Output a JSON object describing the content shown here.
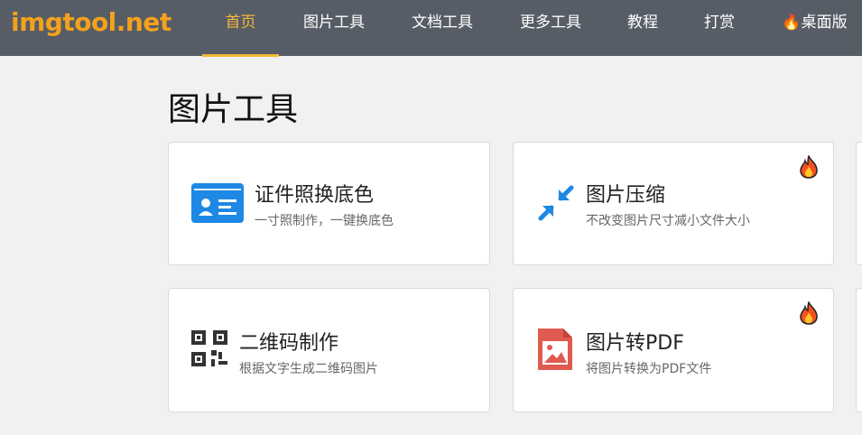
{
  "header": {
    "logo": "imgtool.net",
    "nav": [
      {
        "label": "首页",
        "active": true
      },
      {
        "label": "图片工具"
      },
      {
        "label": "文档工具"
      },
      {
        "label": "更多工具"
      },
      {
        "label": "教程"
      },
      {
        "label": "打赏"
      },
      {
        "label": "🔥桌面版"
      }
    ]
  },
  "section_title": "图片工具",
  "tools": [
    {
      "title": "证件照换底色",
      "desc": "一寸照制作，一键换底色",
      "icon": "id-card-icon",
      "hot": false
    },
    {
      "title": "图片压缩",
      "desc": "不改变图片尺寸减小文件大小",
      "icon": "compress-arrows-icon",
      "hot": true
    },
    {
      "title": "二维码制作",
      "desc": "根据文字生成二维码图片",
      "icon": "qrcode-icon",
      "hot": false
    },
    {
      "title": "图片转PDF",
      "desc": "将图片转换为PDF文件",
      "icon": "image-file-icon",
      "hot": true
    }
  ],
  "colors": {
    "header_bg": "#575d66",
    "logo": "#f5a11b",
    "active_nav": "#f5b73a",
    "blue_icon": "#1e88e5",
    "red_icon": "#e05a4f",
    "dark_icon": "#333333"
  }
}
